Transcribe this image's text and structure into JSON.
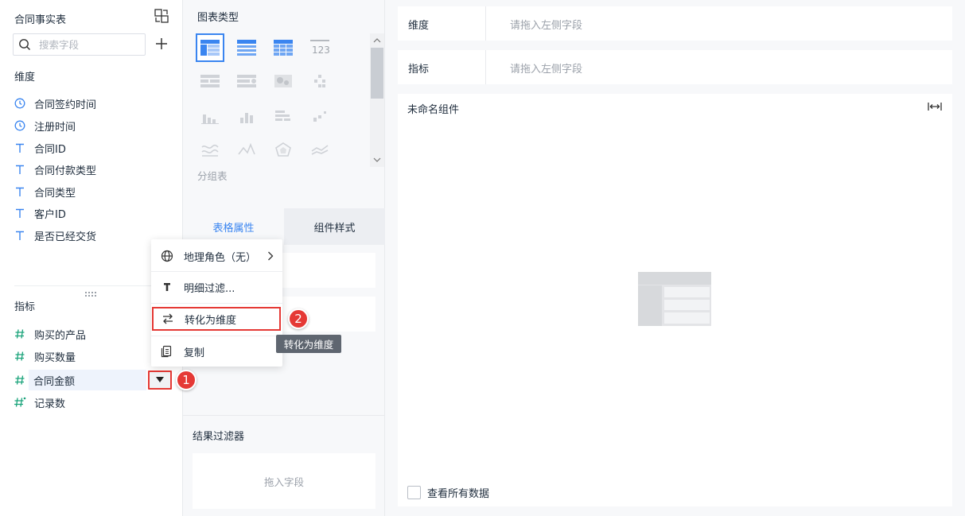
{
  "left_panel": {
    "title": "合同事实表",
    "search": {
      "placeholder": "搜索字段",
      "value": ""
    },
    "dimension_header": "维度",
    "dimensions": [
      {
        "label": "合同签约时间",
        "icon": "clock-icon"
      },
      {
        "label": "注册时间",
        "icon": "clock-icon"
      },
      {
        "label": "合同ID",
        "icon": "text-field-icon"
      },
      {
        "label": "合同付款类型",
        "icon": "text-field-icon"
      },
      {
        "label": "合同类型",
        "icon": "text-field-icon"
      },
      {
        "label": "客户ID",
        "icon": "text-field-icon"
      },
      {
        "label": "是否已经交货",
        "icon": "text-field-icon"
      }
    ],
    "measure_header": "指标",
    "measures": [
      {
        "label": "购买的产品",
        "icon": "number-field-icon"
      },
      {
        "label": "购买数量",
        "icon": "number-field-icon"
      },
      {
        "label": "合同金额",
        "icon": "number-field-icon",
        "selected": true
      },
      {
        "label": "记录数",
        "icon": "count-field-icon"
      }
    ]
  },
  "middle_panel": {
    "chart_types_title": "图表类型",
    "group_label": "分组表",
    "tabs": [
      {
        "label": "表格属性",
        "active": true
      },
      {
        "label": "组件样式",
        "active": false
      }
    ],
    "result_filter": {
      "title": "结果过滤器",
      "placeholder": "拖入字段"
    }
  },
  "context_menu": {
    "items": [
      {
        "label": "地理角色（无）",
        "icon": "globe-icon",
        "submenu": true
      },
      {
        "label": "明细过滤...",
        "icon": "filter-icon"
      },
      {
        "label": "转化为维度",
        "icon": "convert-icon",
        "highlighted": true
      },
      {
        "label": "复制",
        "icon": "copy-icon"
      }
    ],
    "tooltip": "转化为维度"
  },
  "annotations": {
    "step1": "1",
    "step2": "2",
    "color": "#e53935"
  },
  "right_panel": {
    "dimension_shelf": {
      "label": "维度",
      "placeholder": "请拖入左侧字段"
    },
    "measure_shelf": {
      "label": "指标",
      "placeholder": "请拖入左侧字段"
    },
    "component_title": "未命名组件",
    "view_all_label": "查看所有数据"
  },
  "colors": {
    "accent": "#3a85f0",
    "highlight": "#e53935",
    "field_icon": "#3a85f0",
    "measure_icon": "#1aa37a"
  }
}
